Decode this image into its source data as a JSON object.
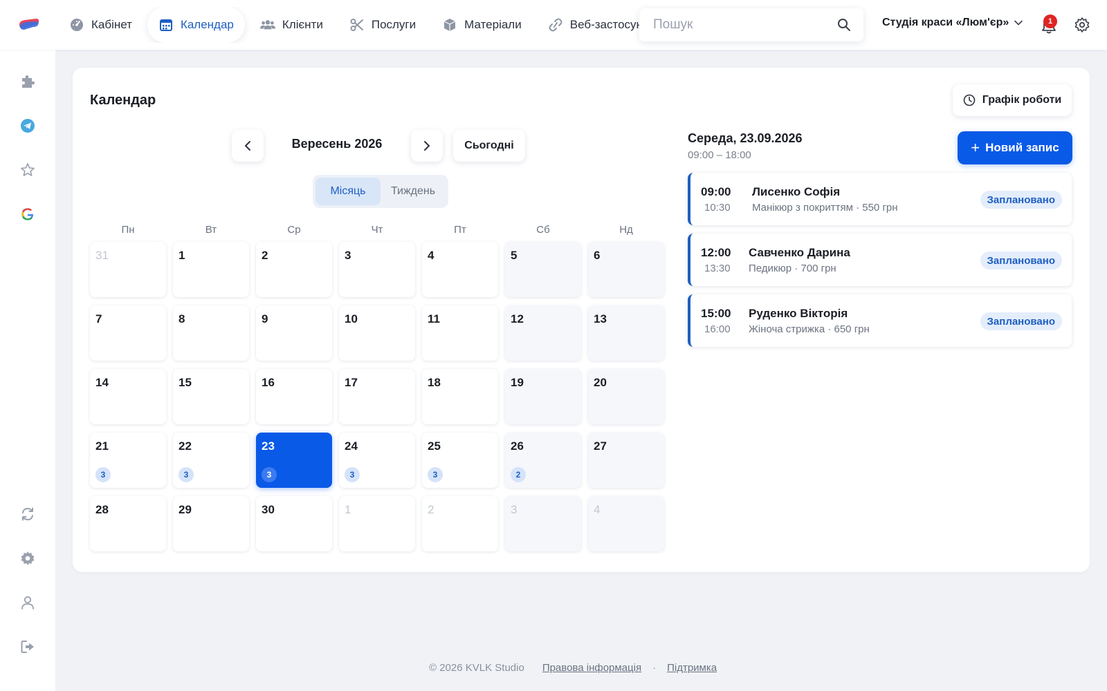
{
  "nav": {
    "items": [
      {
        "label": "Кабінет",
        "icon": "dashboard-icon"
      },
      {
        "label": "Календар",
        "icon": "calendar-icon"
      },
      {
        "label": "Клієнти",
        "icon": "users-icon"
      },
      {
        "label": "Послуги",
        "icon": "scissors-icon"
      },
      {
        "label": "Матеріали",
        "icon": "box-icon"
      },
      {
        "label": "Веб-застосунок",
        "icon": "link-icon"
      }
    ],
    "active_index": 1
  },
  "search": {
    "placeholder": "Пошук",
    "value": ""
  },
  "header": {
    "studio_name": "Студія краси «Люм'єр»",
    "notification_count": "1"
  },
  "sidebar": {
    "top_icons": [
      "puzzle-icon",
      "telegram-icon",
      "star-icon",
      "google-icon"
    ],
    "bottom_icons": [
      "sync-icon",
      "settings-icon",
      "user-icon",
      "logout-icon"
    ]
  },
  "calendar": {
    "title": "Календар",
    "schedule_button": "Графік роботи",
    "month_label": "Вересень 2026",
    "today_button": "Сьогодні",
    "view_options": [
      "Місяць",
      "Тиждень"
    ],
    "active_view": 0,
    "weekdays": [
      "Пн",
      "Вт",
      "Ср",
      "Чт",
      "Пт",
      "Сб",
      "Нд"
    ],
    "days": [
      {
        "n": "31",
        "other": true
      },
      {
        "n": "1"
      },
      {
        "n": "2"
      },
      {
        "n": "3"
      },
      {
        "n": "4"
      },
      {
        "n": "5"
      },
      {
        "n": "6"
      },
      {
        "n": "7"
      },
      {
        "n": "8"
      },
      {
        "n": "9"
      },
      {
        "n": "10"
      },
      {
        "n": "11"
      },
      {
        "n": "12"
      },
      {
        "n": "13"
      },
      {
        "n": "14"
      },
      {
        "n": "15"
      },
      {
        "n": "16"
      },
      {
        "n": "17"
      },
      {
        "n": "18"
      },
      {
        "n": "19"
      },
      {
        "n": "20"
      },
      {
        "n": "21",
        "count": "3"
      },
      {
        "n": "22",
        "count": "3"
      },
      {
        "n": "23",
        "count": "3",
        "selected": true
      },
      {
        "n": "24",
        "count": "3"
      },
      {
        "n": "25",
        "count": "3"
      },
      {
        "n": "26",
        "count": "2"
      },
      {
        "n": "27"
      },
      {
        "n": "28"
      },
      {
        "n": "29"
      },
      {
        "n": "30"
      },
      {
        "n": "1",
        "other": true
      },
      {
        "n": "2",
        "other": true
      },
      {
        "n": "3",
        "other": true
      },
      {
        "n": "4",
        "other": true
      }
    ]
  },
  "day_panel": {
    "date_title": "Середа, 23.09.2026",
    "work_hours": "09:00 – 18:00",
    "new_button": "Новий запис",
    "appointments": [
      {
        "start": "09:00",
        "end": "10:30",
        "client": "Лисенко Софія",
        "details": "Манікюр з покриттям · 550 грн",
        "status": "Заплановано"
      },
      {
        "start": "12:00",
        "end": "13:30",
        "client": "Савченко Дарина",
        "details": "Педикюр · 700 грн",
        "status": "Заплановано"
      },
      {
        "start": "15:00",
        "end": "16:00",
        "client": "Руденко Вікторія",
        "details": "Жіноча стрижка · 650 грн",
        "status": "Заплановано"
      }
    ]
  },
  "footer": {
    "copyright": "© 2026 KVLK Studio",
    "legal_link": "Правова інформація",
    "separator": "·",
    "support_link": "Підтримка"
  },
  "colors": {
    "accent": "#0a5ae8",
    "nav_active": "#1e5fc2",
    "badge": "#e02424"
  }
}
